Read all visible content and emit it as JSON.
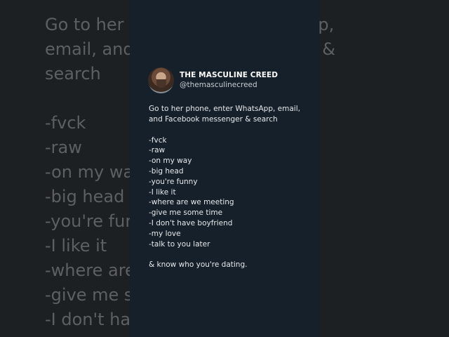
{
  "background": {
    "lines": [
      "Go to her phone, enter WhatsApp,",
      "email, and Facebook messenger &",
      "search",
      "",
      "-fvck",
      "-raw",
      "-on my way",
      "-big head",
      "-you're funny",
      "-I like it",
      "-where are we meeting",
      "-give me some time",
      "-I don't have boyfriend"
    ]
  },
  "post": {
    "author_name": "THE MASCULINE CREED",
    "author_handle": "@themasculinecreed",
    "intro": "Go to her phone, enter WhatsApp, email, and Facebook messenger & search",
    "items": [
      "-fvck",
      "-raw",
      "-on my way",
      "-big head",
      "-you're funny",
      "-I like it",
      "-where are we meeting",
      "-give me some time",
      "-I don't have boyfriend",
      "-my love",
      "-talk to you later"
    ],
    "outro": "& know who you're dating."
  },
  "colors": {
    "card_bg": "#15202b",
    "page_bg": "#1d2023",
    "text": "#e7e9ea"
  }
}
